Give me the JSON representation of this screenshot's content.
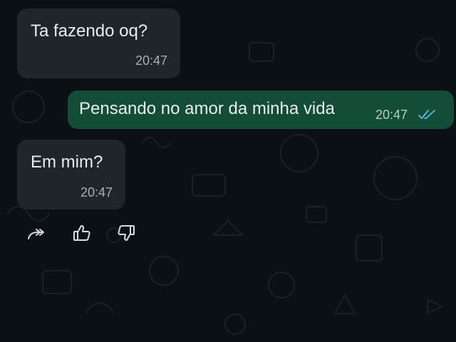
{
  "colors": {
    "background": "#0b1014",
    "incoming_bubble": "#1f2528",
    "outgoing_bubble": "#134d37",
    "text": "#e9edef",
    "timestamp": "#a7b0b5",
    "read_ticks": "#53bdeb"
  },
  "messages": [
    {
      "direction": "incoming",
      "text": "Ta fazendo oq?",
      "time": "20:47"
    },
    {
      "direction": "outgoing",
      "text": "Pensando no amor da minha vida",
      "time": "20:47",
      "status": "read"
    },
    {
      "direction": "incoming",
      "text": "Em mim?",
      "time": "20:47"
    }
  ],
  "reactions": {
    "icons": [
      "forward-icon",
      "thumbs-up-icon",
      "thumbs-down-icon"
    ]
  }
}
